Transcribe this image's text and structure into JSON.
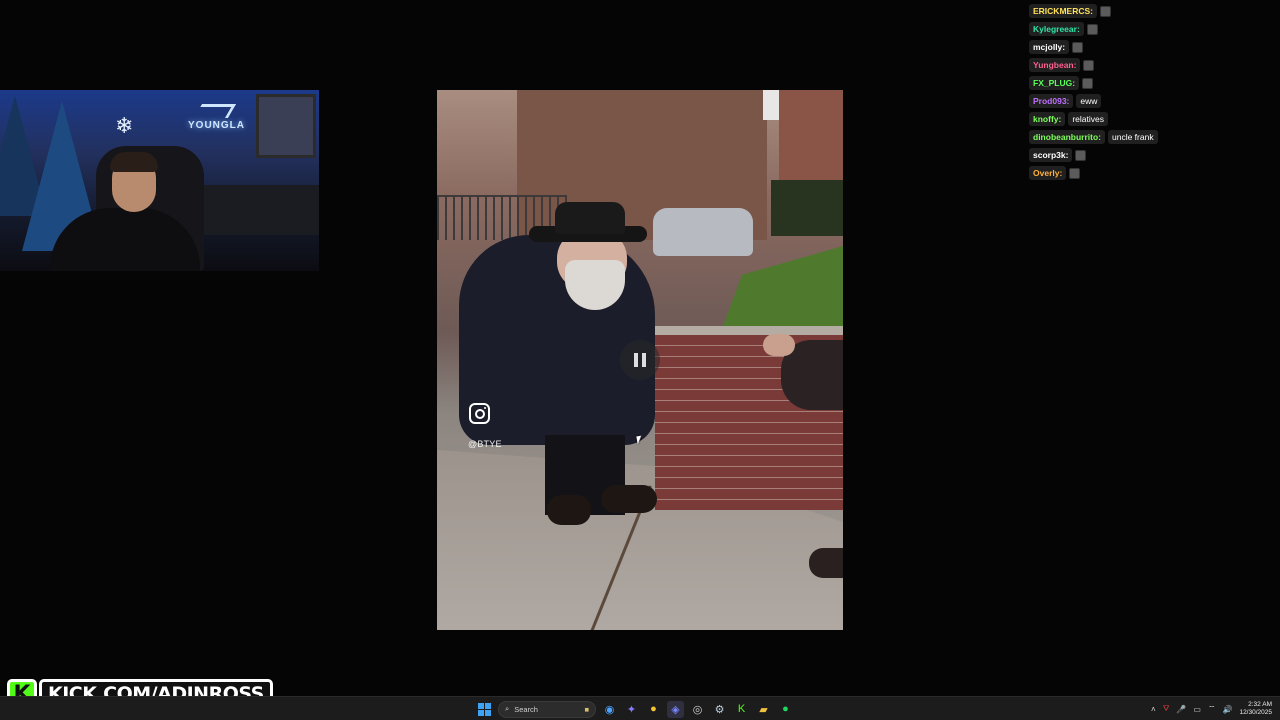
{
  "chat": {
    "messages": [
      {
        "user": "ERICKMERCS:",
        "user_color": "#ffe15a",
        "message": "",
        "emote": true
      },
      {
        "user": "Kylegreear:",
        "user_color": "#2ee6a6",
        "message": "",
        "emote": true
      },
      {
        "user": "mcjolly:",
        "user_color": "#ffffff",
        "message": "",
        "emote": true
      },
      {
        "user": "Yungbean:",
        "user_color": "#ff5f8f",
        "message": "",
        "emote": true
      },
      {
        "user": "FX_PLUG:",
        "user_color": "#59ff59",
        "message": "",
        "emote": true
      },
      {
        "user": "Prod093:",
        "user_color": "#c070ff",
        "message": "eww",
        "emote": false
      },
      {
        "user": "knoffy:",
        "user_color": "#7dff5a",
        "message": "relatives",
        "emote": false
      },
      {
        "user": "dinobeanburrito:",
        "user_color": "#7dff5a",
        "message": "uncle frank",
        "emote": false
      },
      {
        "user": "scorp3k:",
        "user_color": "#ffffff",
        "message": "",
        "emote": true
      },
      {
        "user": "Overly:",
        "user_color": "#ffb13a",
        "message": "",
        "emote": true
      }
    ]
  },
  "webcam": {
    "brand_text": "YOUNGLA"
  },
  "video": {
    "watermark_handle": "@BTYE",
    "state": "paused"
  },
  "overlay": {
    "kick_letter": "K",
    "kick_url": "KICK.COM/ADINROSS",
    "brand_color": "#53fc18"
  },
  "taskbar": {
    "search_placeholder": "Search",
    "time": "2:32 AM",
    "date": "12/30/2025"
  }
}
